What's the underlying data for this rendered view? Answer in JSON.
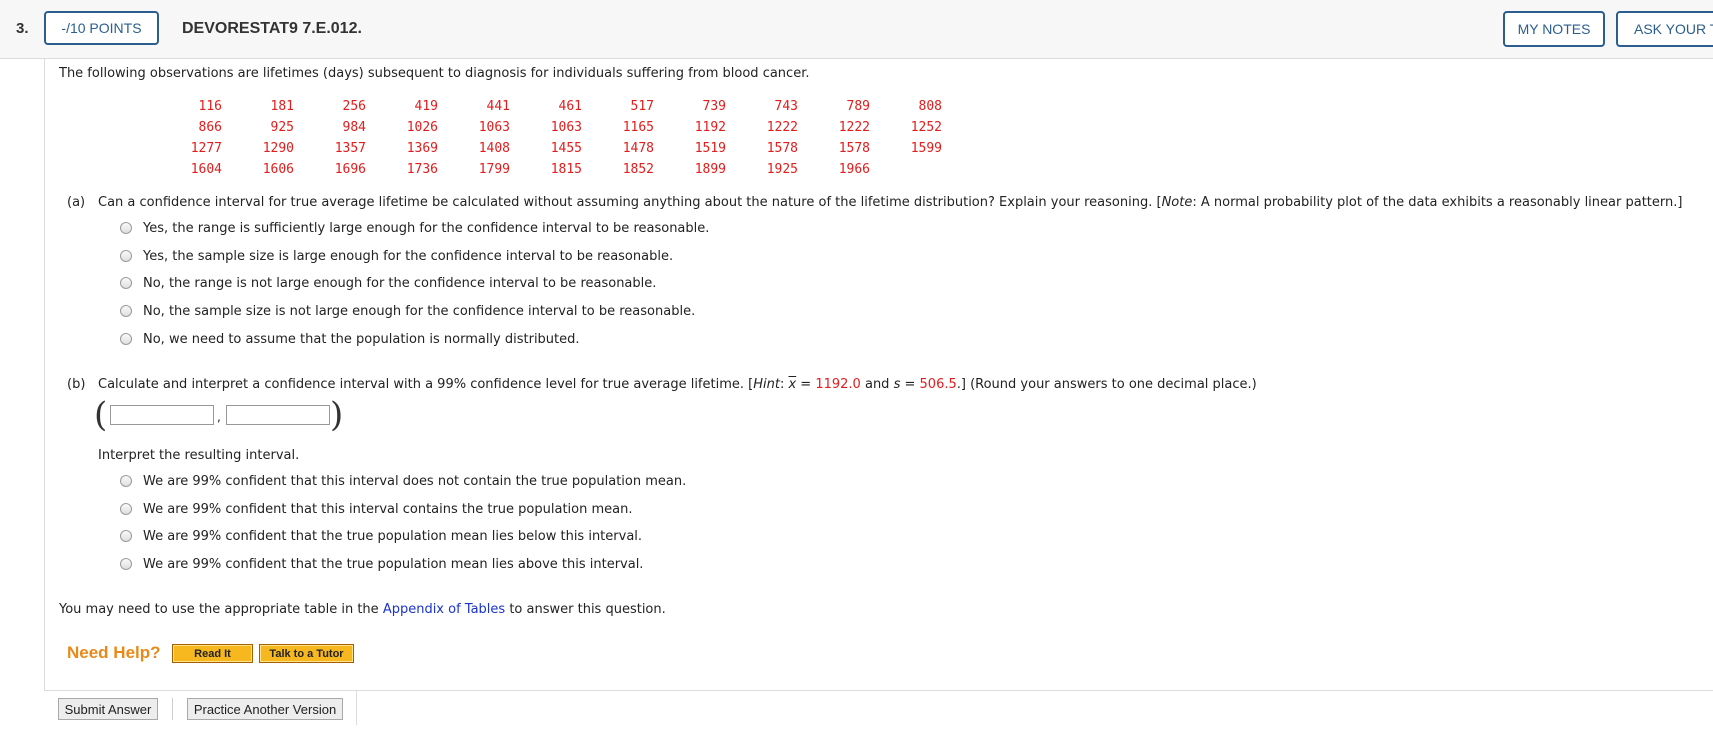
{
  "header": {
    "question_number": "3.",
    "points_label": "-/10 POINTS",
    "question_id": "DEVORESTAT9 7.E.012.",
    "my_notes_label": "MY NOTES",
    "ask_teacher_label": "ASK YOUR TEACHER"
  },
  "question": {
    "intro": "The following observations are lifetimes (days) subsequent to diagnosis for individuals suffering from blood cancer.",
    "data_rows": [
      [
        "116",
        "181",
        "256",
        "419",
        "441",
        "461",
        "517",
        "739",
        "743",
        "789",
        "808"
      ],
      [
        "866",
        "925",
        "984",
        "1026",
        "1063",
        "1063",
        "1165",
        "1192",
        "1222",
        "1222",
        "1252"
      ],
      [
        "1277",
        "1290",
        "1357",
        "1369",
        "1408",
        "1455",
        "1478",
        "1519",
        "1578",
        "1578",
        "1599"
      ],
      [
        "1604",
        "1606",
        "1696",
        "1736",
        "1799",
        "1815",
        "1852",
        "1899",
        "1925",
        "1966",
        ""
      ]
    ]
  },
  "part_a": {
    "label": "(a)",
    "prompt": "Can a confidence interval for true average lifetime be calculated without assuming anything about the nature of the lifetime distribution? Explain your reasoning. [",
    "note_word": "Note",
    "note_text": ": A normal probability plot of the data exhibits a reasonably linear pattern.]",
    "options": [
      "Yes, the range is sufficiently large enough for the confidence interval to be reasonable.",
      "Yes, the sample size is large enough for the confidence interval to be reasonable.",
      "No, the range is not large enough for the confidence interval to be reasonable.",
      "No, the sample size is not large enough for the confidence interval to be reasonable.",
      "No, we need to assume that the population is normally distributed."
    ]
  },
  "part_b": {
    "label": "(b)",
    "prompt_1": "Calculate and interpret a confidence interval with a 99% confidence level for true average lifetime. [",
    "hint_word": "Hint",
    "hint_colon": ": ",
    "xbar_symbol": "x",
    "equals_1": " = ",
    "xbar_value": "1192.0",
    "and_s": " and ",
    "s_symbol": "s",
    "equals_2": " = ",
    "s_value": "506.5",
    "prompt_end": ".] (Round your answers to one decimal place.)",
    "open_paren": "(",
    "comma": ",",
    "close_paren": ")",
    "lower_value": "",
    "upper_value": "",
    "interpret_label": "Interpret the resulting interval.",
    "options": [
      "We are 99% confident that this interval does not contain the true population mean.",
      "We are 99% confident that this interval contains the true population mean.",
      "We are 99% confident that the true population mean lies below this interval.",
      "We are 99% confident that the true population mean lies above this interval."
    ]
  },
  "appendix": {
    "text_before": "You may need to use the appropriate table in the ",
    "link_text": "Appendix of Tables",
    "text_after": " to answer this question."
  },
  "help": {
    "label": "Need Help?",
    "read_it": "Read It",
    "talk_tutor": "Talk to a Tutor"
  },
  "footer": {
    "submit_label": "Submit Answer",
    "practice_label": "Practice Another Version"
  }
}
